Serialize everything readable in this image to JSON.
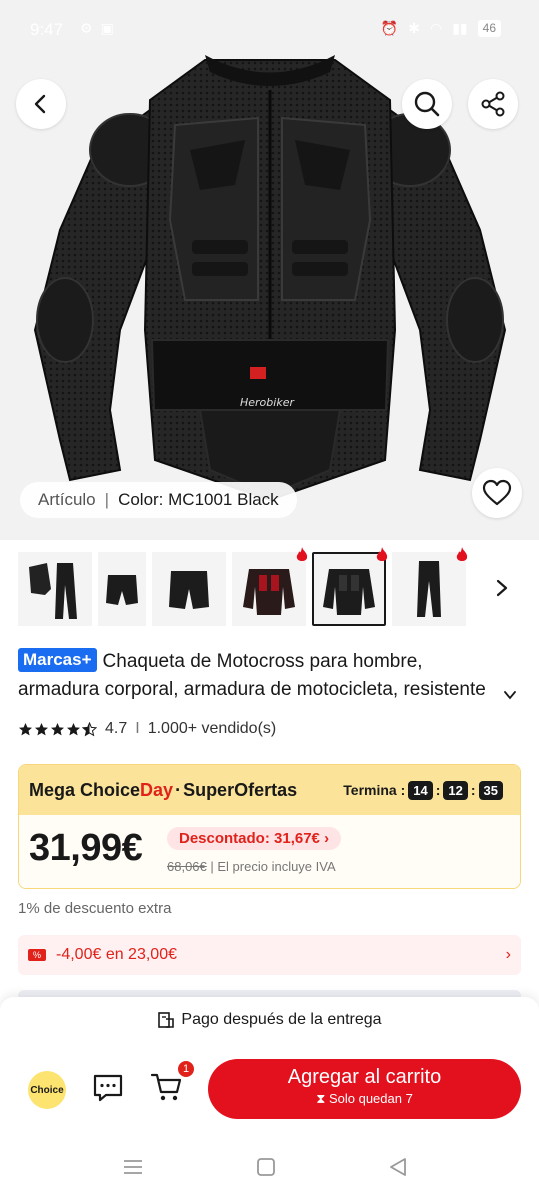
{
  "status_bar": {
    "time": "9:47",
    "battery": "46"
  },
  "hero": {
    "brand_on_product": "Herobiker",
    "variant_label": "Artículo",
    "variant_separator": "|",
    "variant_value": "Color: MC1001 Black"
  },
  "thumbnails": [
    {
      "name": "traje-completo",
      "selected": false,
      "hot": false
    },
    {
      "name": "pantalon-corto",
      "selected": false,
      "hot": false
    },
    {
      "name": "pantalon-corto-2",
      "selected": false,
      "hot": false
    },
    {
      "name": "chaqueta-roja",
      "selected": false,
      "hot": true
    },
    {
      "name": "chaqueta-negra",
      "selected": true,
      "hot": true
    },
    {
      "name": "pantalon-largo",
      "selected": false,
      "hot": true
    }
  ],
  "product": {
    "brand_badge": "Marcas+",
    "title_line1": "Chaqueta de Motocross para hombre,",
    "title_line2": "armadura corporal, armadura de motocicleta, resistente",
    "rating": "4.7",
    "rating_divider": "I",
    "sold": "1.000+ vendido(s)",
    "stars": 4.5
  },
  "deal": {
    "title_prefix": "Mega ",
    "title_choice": "Choice",
    "title_day": "Day",
    "title_dot": "·",
    "title_suffix": "SuperOfertas",
    "ends_label": "Termina :",
    "timer_h": "14",
    "timer_m": "12",
    "timer_s": "35",
    "timer_sep": ":",
    "price": "31,99€",
    "discount": "Descontado: 31,67€",
    "old_price": "68,06€",
    "tax_note": "| El precio incluye IVA"
  },
  "extra_discount": "1% de descuento extra",
  "coupon": {
    "icon_text": "%",
    "text": "-4,00€ en 23,00€"
  },
  "bottom": {
    "pay_later": "Pago después de la entrega",
    "choice_label": "Choice",
    "cart_count": "1",
    "add_to_cart": "Agregar al carrito",
    "stock_note": "Solo quedan 7"
  },
  "colors": {
    "accent_red": "#e3101e",
    "deal_yellow": "#fbe49a",
    "brand_blue": "#1a6cf0"
  }
}
